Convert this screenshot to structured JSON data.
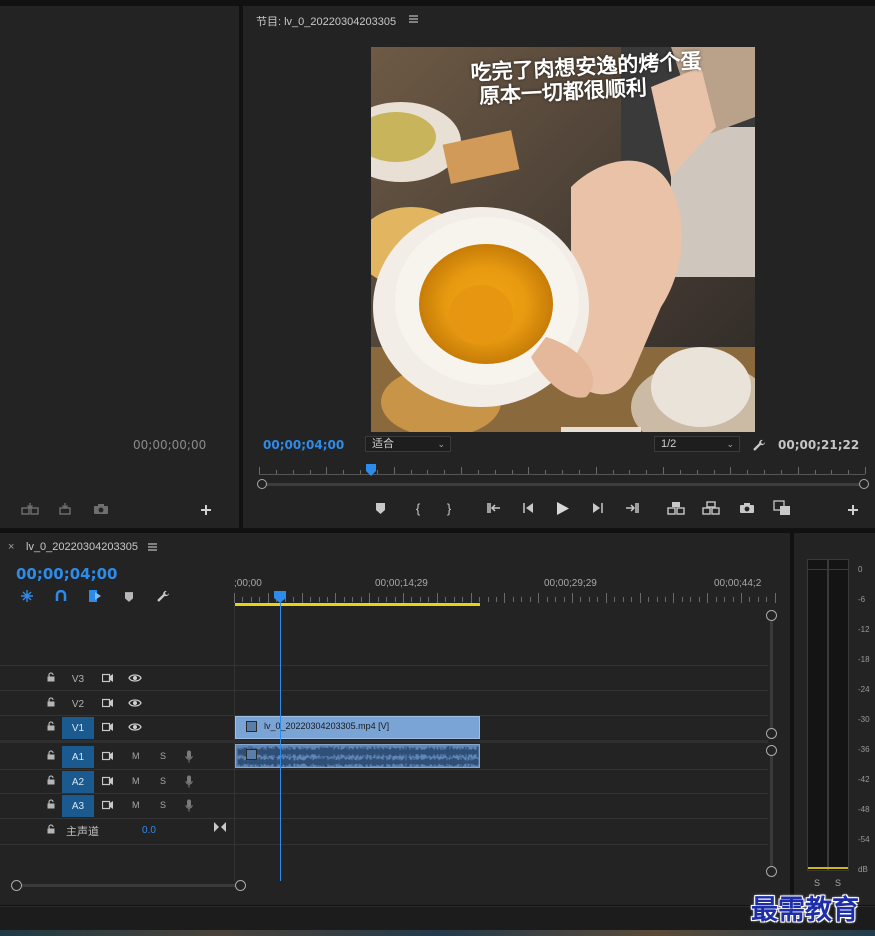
{
  "source_monitor": {
    "timecode": "00;00;00;00"
  },
  "program_monitor": {
    "title": "节目: lv_0_20220304203305",
    "menu_icon": "hamburger-icon",
    "current_timecode": "00;00;04;00",
    "duration_timecode": "00;00;21;22",
    "fit_label": "适合",
    "resolution_label": "1/2",
    "caption_line1": "吃完了肉想安逸的烤个蛋",
    "caption_line2": "原本一切都很顺利",
    "playhead_fraction": 0.185
  },
  "timeline": {
    "close_icon": "×",
    "sequence_name": "lv_0_20220304203305",
    "current_timecode": "00;00;04;00",
    "ruler_labels": [
      ";00;00",
      "00;00;14;29",
      "00;00;29;29",
      "00;00;44;2"
    ],
    "video_tracks": [
      {
        "name": "V3",
        "active": false
      },
      {
        "name": "V2",
        "active": false
      },
      {
        "name": "V1",
        "active": true
      }
    ],
    "audio_tracks": [
      {
        "name": "A1",
        "active": true,
        "m": "M",
        "s": "S"
      },
      {
        "name": "A2",
        "active": true,
        "m": "M",
        "s": "S"
      },
      {
        "name": "A3",
        "active": true,
        "m": "M",
        "s": "S"
      }
    ],
    "master": {
      "label": "主声道",
      "value": "0.0"
    },
    "video_clip_label": "lv_0_20220304203305.mp4 [V]"
  },
  "audio_meter": {
    "labels": [
      "0",
      "-6",
      "-12",
      "-18",
      "-24",
      "-30",
      "-36",
      "-42",
      "-48",
      "-54",
      "dB"
    ],
    "solo_labels": [
      "S",
      "S"
    ]
  },
  "watermark": "最需教育",
  "colors": {
    "accent_blue": "#2d8ceb",
    "clip_video": "#7aa4d6",
    "clip_audio": "#5f86b4",
    "work_area": "#e8d21a"
  }
}
